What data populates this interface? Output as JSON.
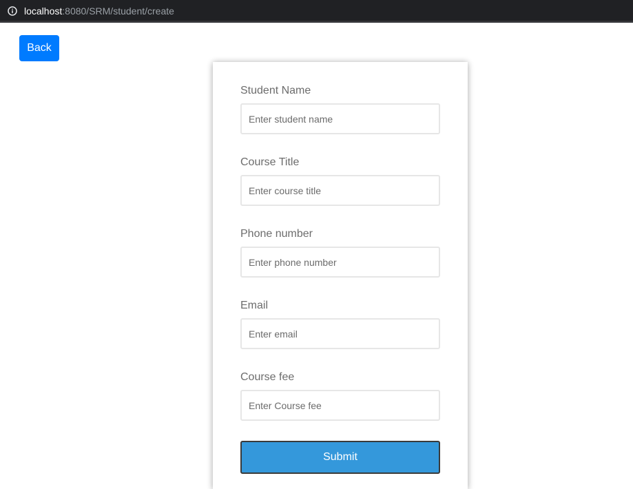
{
  "browser": {
    "url_host": "localhost",
    "url_path": ":8080/SRM/student/create",
    "info_icon": "info-circle-icon"
  },
  "back_button": {
    "label": "Back",
    "color": "#007bff"
  },
  "form": {
    "fields": [
      {
        "label": "Student Name",
        "placeholder": "Enter student name"
      },
      {
        "label": "Course Title",
        "placeholder": "Enter course title"
      },
      {
        "label": "Phone number",
        "placeholder": "Enter phone number"
      },
      {
        "label": "Email",
        "placeholder": "Enter email"
      },
      {
        "label": "Course fee",
        "placeholder": "Enter Course fee"
      }
    ],
    "submit_label": "Submit",
    "submit_color": "#3498db"
  }
}
